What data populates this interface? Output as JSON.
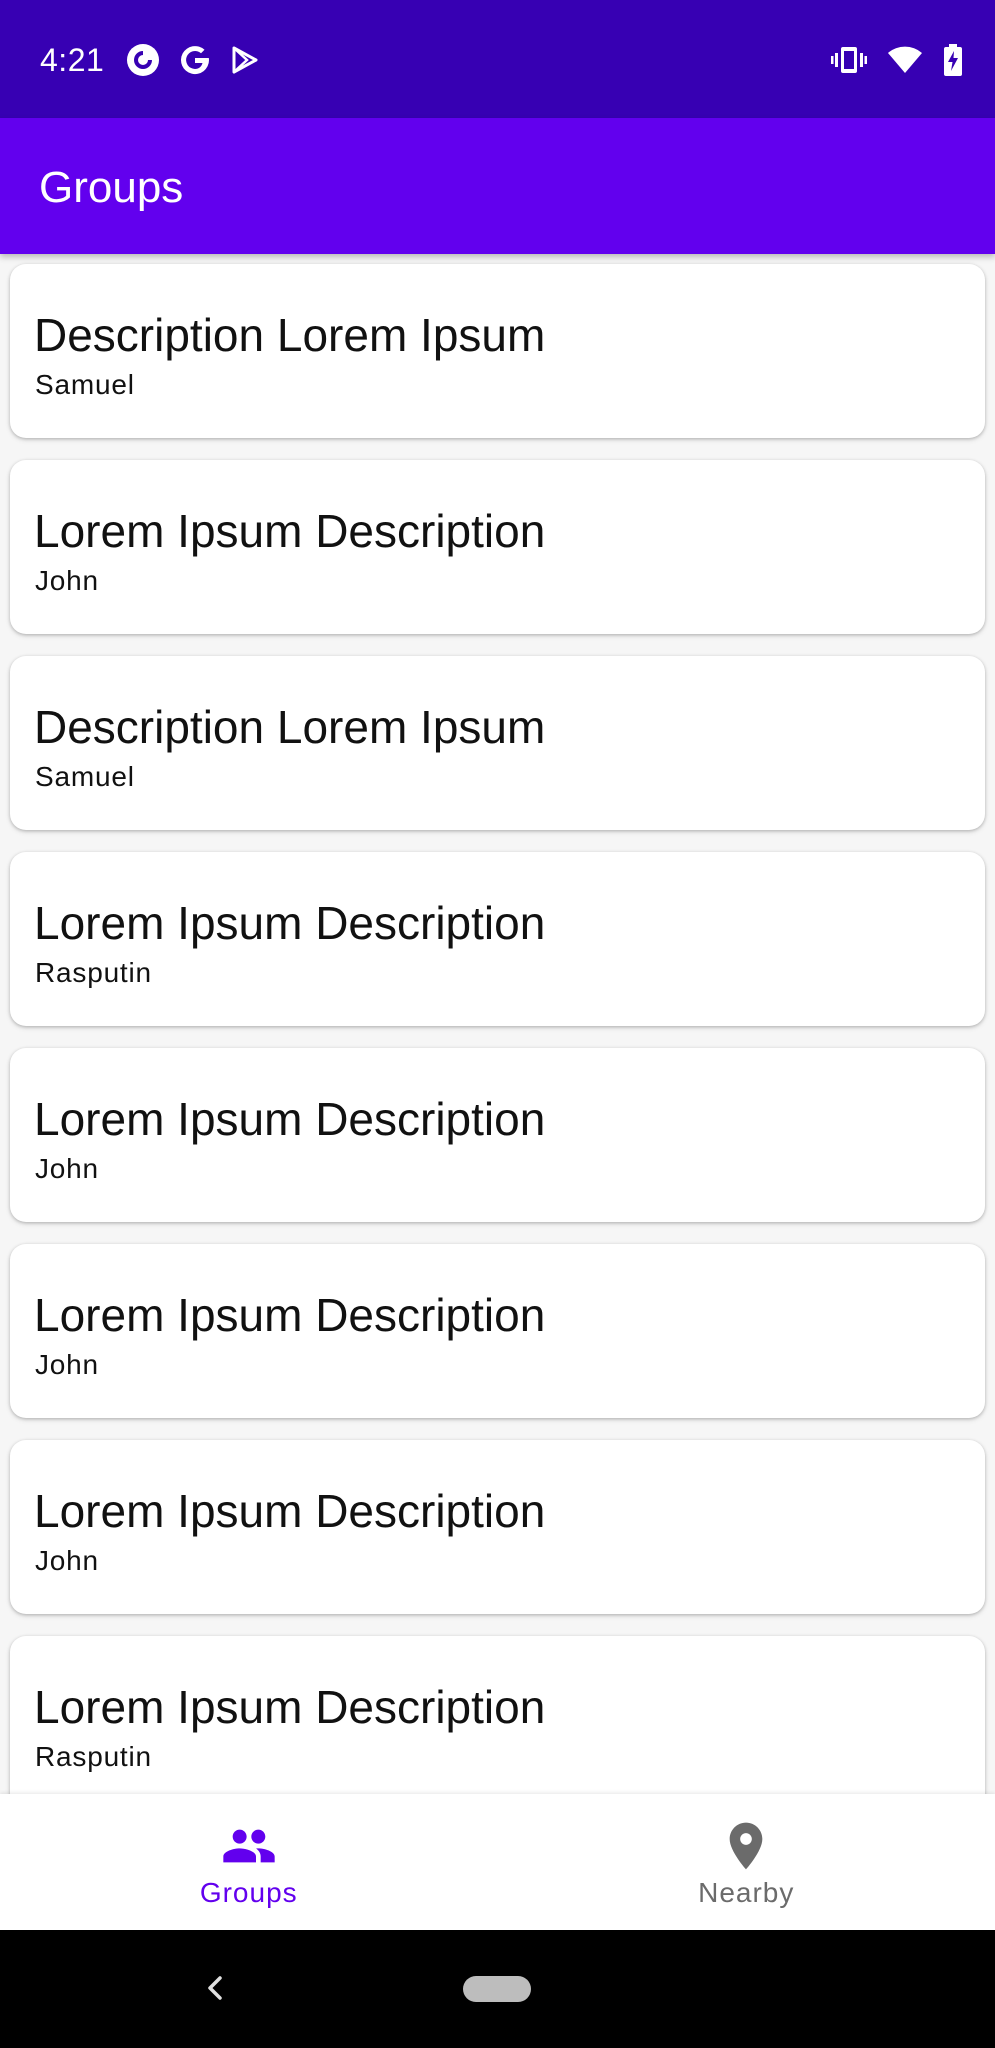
{
  "status_bar": {
    "time": "4:21",
    "left_icons": [
      "pocket-casts-icon",
      "google-icon",
      "play-store-icon"
    ],
    "right_icons": [
      "vibrate-icon",
      "wifi-icon",
      "battery-charging-icon"
    ],
    "color": "#3700b3"
  },
  "app_bar": {
    "title": "Groups",
    "color": "#6200ee"
  },
  "groups": [
    {
      "title": "Description Lorem Ipsum",
      "author": "Samuel"
    },
    {
      "title": "Lorem Ipsum Description",
      "author": "John"
    },
    {
      "title": "Description Lorem Ipsum",
      "author": "Samuel"
    },
    {
      "title": "Lorem Ipsum Description",
      "author": "Rasputin"
    },
    {
      "title": "Lorem Ipsum Description",
      "author": "John"
    },
    {
      "title": "Lorem Ipsum Description",
      "author": "John"
    },
    {
      "title": "Lorem Ipsum Description",
      "author": "John"
    },
    {
      "title": "Lorem Ipsum Description",
      "author": "Rasputin"
    }
  ],
  "bottom_nav": {
    "items": [
      {
        "label": "Groups",
        "icon": "group-icon",
        "active": true
      },
      {
        "label": "Nearby",
        "icon": "location-pin-icon",
        "active": false
      }
    ],
    "active_color": "#6200ee",
    "inactive_color": "#6b6b6b"
  },
  "system_nav": {
    "buttons": [
      "back-icon",
      "home-pill"
    ]
  }
}
